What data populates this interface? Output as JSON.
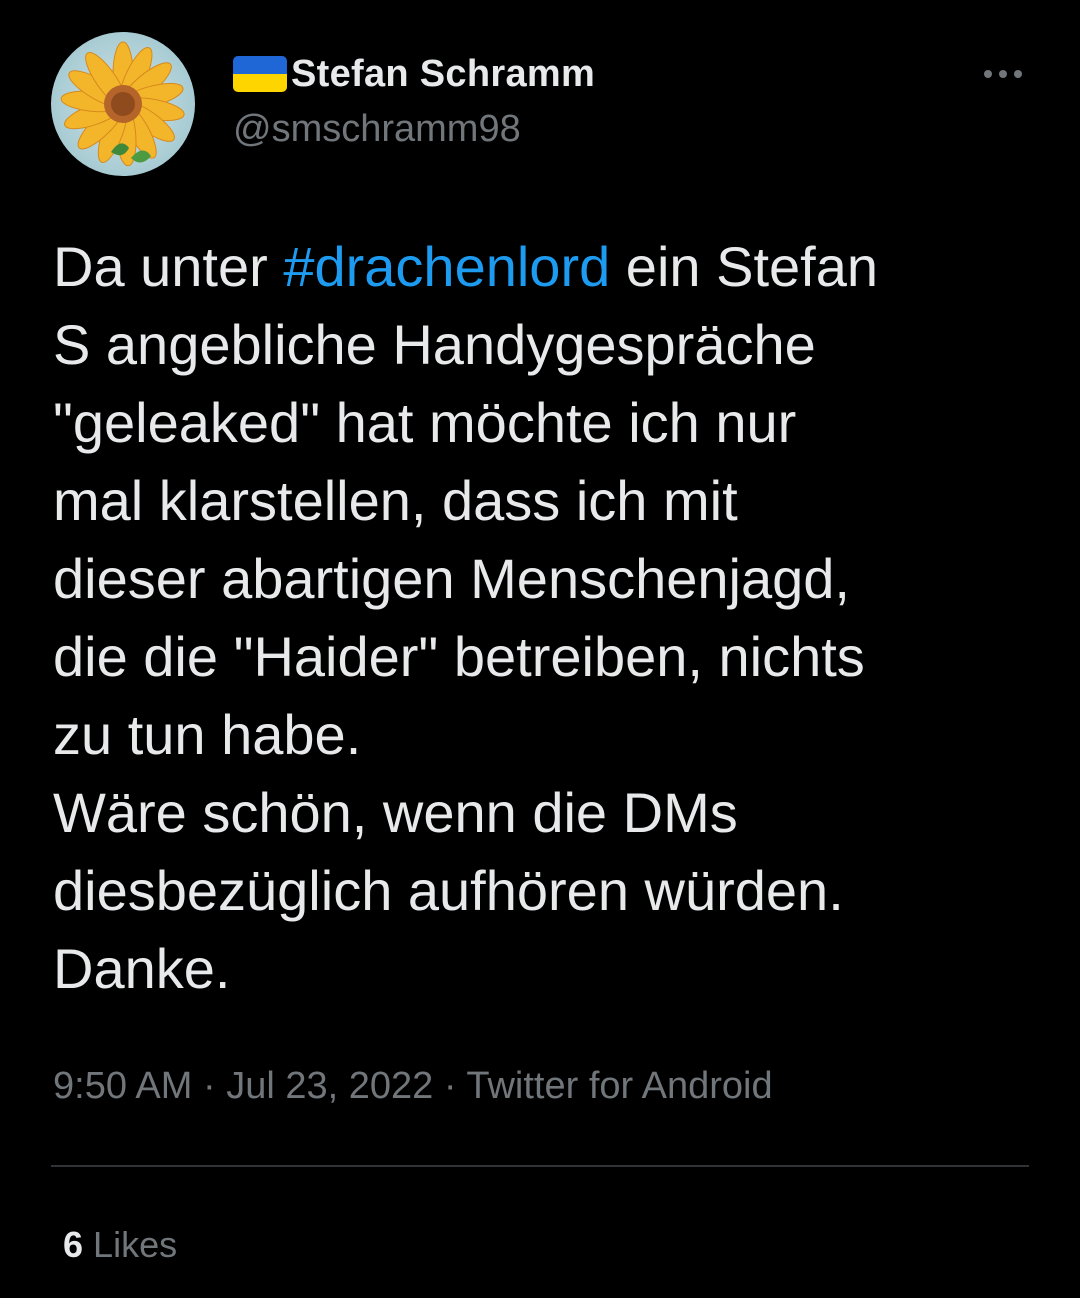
{
  "tweet": {
    "author": {
      "flag": "ukraine-flag",
      "display_name": "Stefan Schramm",
      "handle": "@smschramm98",
      "avatar": "sunflower-avatar"
    },
    "text_before_hashtag": "Da unter ",
    "hashtag": "#drachenlord",
    "text_after_hashtag": " ein Stefan\nS angebliche Handygespräche\n\"geleaked\" hat möchte ich nur\nmal klarstellen, dass ich mit\ndieser abartigen Menschenjagd,\ndie die \"Haider\" betreiben, nichts\nzu tun habe.\nWäre schön, wenn die DMs\ndiesbezüglich aufhören würden.\nDanke.",
    "time": "9:50 AM",
    "date": "Jul 23, 2022",
    "source": "Twitter for Android",
    "separator": " · ",
    "likes_count": "6",
    "likes_label": "Likes"
  },
  "colors": {
    "background": "#000000",
    "text": "#e7e9ea",
    "secondary": "#71767b",
    "link": "#1d9bf0",
    "divider": "#2f3336"
  }
}
